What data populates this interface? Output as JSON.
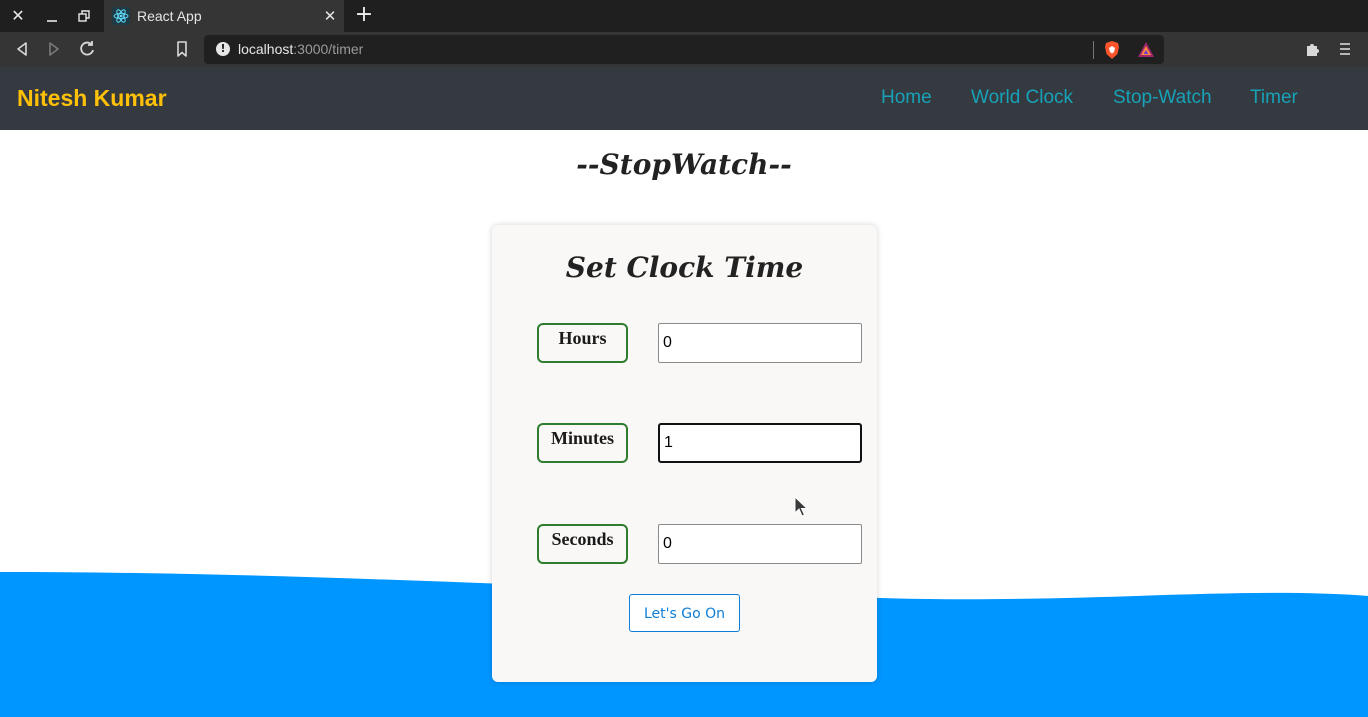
{
  "browser": {
    "tab_title": "React App",
    "url_host": "localhost",
    "url_path": ":3000/timer"
  },
  "navbar": {
    "brand": "Nitesh Kumar",
    "links": [
      {
        "label": "Home"
      },
      {
        "label": "World Clock"
      },
      {
        "label": "Stop-Watch"
      },
      {
        "label": "Timer"
      }
    ],
    "colors": {
      "background": "#343a40",
      "brand": "#ffc107",
      "link": "#17a2b8"
    }
  },
  "page": {
    "heading": "--StopWatch--",
    "wave_color": "#0096ff"
  },
  "form": {
    "title": "Set Clock Time",
    "fields": [
      {
        "label": "Hours",
        "value": "0"
      },
      {
        "label": "Minutes",
        "value": "1"
      },
      {
        "label": "Seconds",
        "value": "0"
      }
    ],
    "submit_label": "Let's Go On",
    "accent": "#0d7dd6",
    "label_border": "#2e7d2e"
  }
}
